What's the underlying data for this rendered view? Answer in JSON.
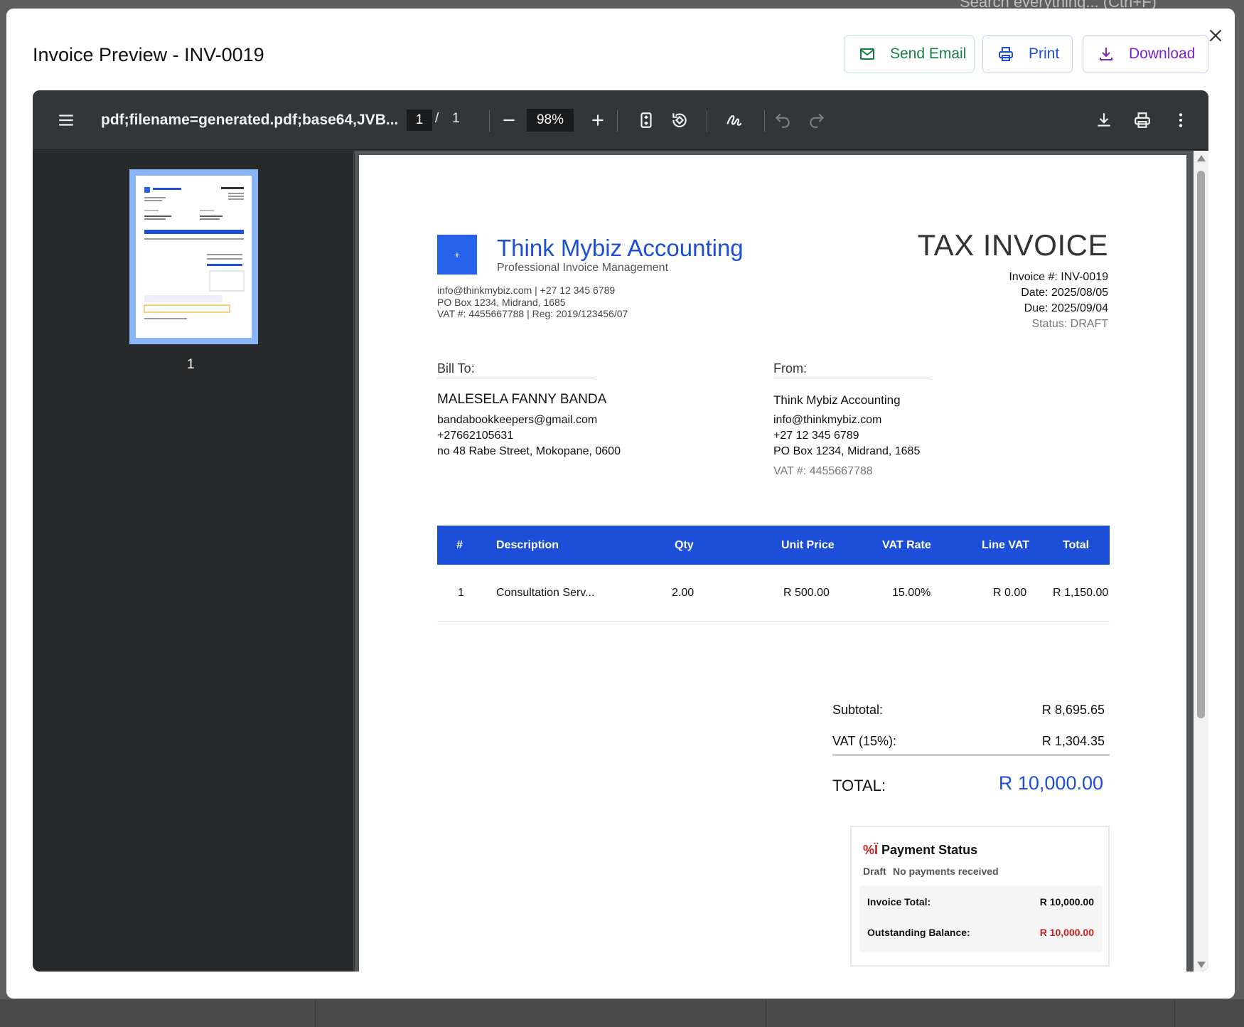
{
  "background": {
    "search_hint": "Search everything... (Ctrl+F)"
  },
  "modal": {
    "title": "Invoice Preview - INV-0019",
    "buttons": {
      "email": "Send Email",
      "print": "Print",
      "download": "Download"
    }
  },
  "viewer": {
    "filename": "pdf;filename=generated.pdf;base64,JVB...",
    "page_current": "1",
    "page_sep": "/",
    "page_total": "1",
    "zoom": "98%",
    "thumbnail_label": "1"
  },
  "invoice": {
    "logo_symbol": "+",
    "company_name": "Think Mybiz Accounting",
    "company_tagline": "Professional Invoice Management",
    "company_contact": "info@thinkmybiz.com | +27 12 345 6789",
    "company_address": "PO Box 1234, Midrand, 1685",
    "company_reg": "VAT #: 4455667788 | Reg: 2019/123456/07",
    "title": "TAX INVOICE",
    "invoice_number": "Invoice #: INV-0019",
    "date": "Date: 2025/08/05",
    "due": "Due: 2025/09/04",
    "status": "Status: DRAFT",
    "bill_to": {
      "label": "Bill To:",
      "name": "MALESELA FANNY BANDA",
      "email": "bandabookkeepers@gmail.com",
      "phone": "+27662105631",
      "address": "no 48 Rabe Street, Mokopane, 0600"
    },
    "from": {
      "label": "From:",
      "name": "Think Mybiz Accounting",
      "email": "info@thinkmybiz.com",
      "phone": "+27 12 345 6789",
      "address": "PO Box 1234, Midrand, 1685",
      "vat": "VAT #: 4455667788"
    },
    "table": {
      "headers": [
        "#",
        "Description",
        "Qty",
        "Unit Price",
        "VAT Rate",
        "Line VAT",
        "Total"
      ],
      "rows": [
        [
          "1",
          "Consultation Serv...",
          "2.00",
          "R 500.00",
          "15.00%",
          "R 0.00",
          "R 1,150.00"
        ]
      ]
    },
    "summary": {
      "subtotal_label": "Subtotal:",
      "subtotal_value": "R 8,695.65",
      "vat_label": "VAT (15%):",
      "vat_value": "R 1,304.35",
      "total_label": "TOTAL:",
      "total_value": "R 10,000.00"
    },
    "payment": {
      "icon_text": "%Ï",
      "title": "Payment Status",
      "state": "Draft",
      "note": "No payments received",
      "invoice_total_label": "Invoice Total:",
      "invoice_total_value": "R 10,000.00",
      "outstanding_label": "Outstanding Balance:",
      "outstanding_value": "R 10,000.00"
    }
  },
  "colors": {
    "brand_blue": "#1d4ed8",
    "email_green": "#15803d",
    "download_purple": "#7e22ce",
    "alert_red": "#c81e1e"
  }
}
